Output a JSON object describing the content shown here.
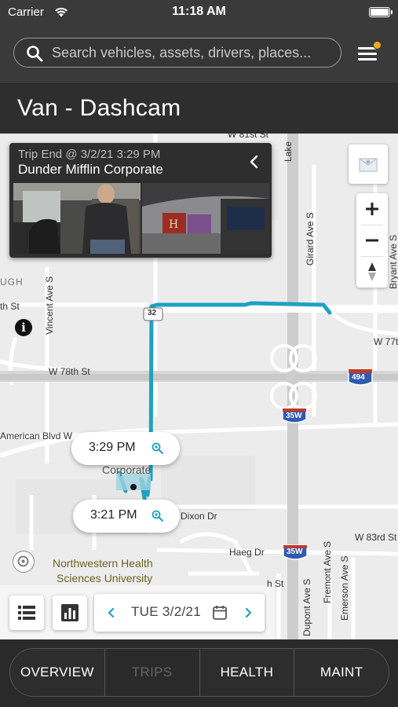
{
  "status_bar": {
    "carrier": "Carrier",
    "time": "11:18 AM"
  },
  "search": {
    "placeholder": "Search vehicles, assets, drivers, places..."
  },
  "menu": {
    "notification_dot_color": "#f5a623"
  },
  "page": {
    "title": "Van - Dashcam"
  },
  "trip_card": {
    "trip_end_label": "Trip End @ 3/2/21 3:29 PM",
    "location": "Dunder Mifflin Corporate",
    "thumbnails": [
      "driver-facing",
      "road-facing"
    ]
  },
  "map": {
    "labels": {
      "w78th": "W 78th St",
      "american_blvd": "American Blvd W",
      "vincent": "Vincent Ave S",
      "girard": "Girard Ave S",
      "bryant": "Bryant Ave S",
      "w77th": "W 77th",
      "th_st": "th St",
      "ugh": "UGH",
      "dixon": "Dixon Dr",
      "haeg": "Haeg Dr",
      "w83rd": "W 83rd St",
      "fremont": "Fremont Ave S",
      "emerson": "Emerson Ave S",
      "dupont": "Dupont Ave S",
      "university_line1": "Northwestern Health",
      "university_line2": "Sciences University",
      "corporate": "Corporate",
      "h_st": "h St",
      "lake": "Lake",
      "w81st": "W 81st St",
      "route_494": "494",
      "route_35w_a": "35W",
      "route_35w_b": "35W",
      "route_32": "32"
    },
    "route_color": "#1ea1c3"
  },
  "time_pills": [
    {
      "time": "3:29 PM"
    },
    {
      "time": "3:21 PM"
    }
  ],
  "date_picker": {
    "date": "TUE 3/2/21",
    "accent_color": "#1ea1c3"
  },
  "tabs": [
    {
      "label": "OVERVIEW",
      "active": false
    },
    {
      "label": "TRIPS",
      "active": true
    },
    {
      "label": "HEALTH",
      "active": false
    },
    {
      "label": "MAINT",
      "active": false
    }
  ]
}
